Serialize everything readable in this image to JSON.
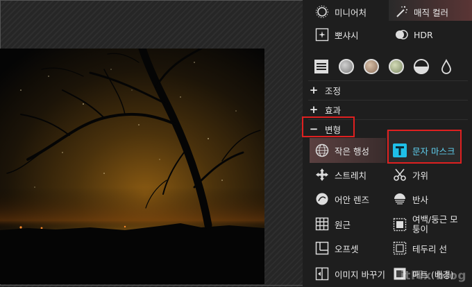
{
  "panel": {
    "top_items": [
      {
        "name": "miniature",
        "label": "미니어처",
        "icon": "sun-dial-icon"
      },
      {
        "name": "magic-color",
        "label": "매직 컬러",
        "icon": "magic-wand-icon"
      },
      {
        "name": "sparkle",
        "label": "뽀샤시",
        "icon": "sparkle-icon"
      },
      {
        "name": "hdr",
        "label": "HDR",
        "icon": "hdr-icon"
      }
    ],
    "sections": {
      "adjust": {
        "sign": "+",
        "label": "조정"
      },
      "effect": {
        "sign": "+",
        "label": "효과"
      },
      "transform": {
        "sign": "−",
        "label": "변형"
      }
    },
    "transform_items": {
      "left": [
        {
          "name": "small-planet",
          "label": "작은 행성",
          "icon": "globe-icon"
        },
        {
          "name": "stretch",
          "label": "스트레치",
          "icon": "move-arrows-icon"
        },
        {
          "name": "fisheye",
          "label": "어안 렌즈",
          "icon": "fisheye-lens-icon"
        },
        {
          "name": "perspective",
          "label": "원근",
          "icon": "perspective-grid-icon"
        },
        {
          "name": "offset",
          "label": "오프셋",
          "icon": "offset-icon"
        },
        {
          "name": "replace-image",
          "label": "이미지 바꾸기",
          "icon": "replace-image-icon"
        }
      ],
      "right": [
        {
          "name": "text-mask",
          "label": "문자 마스크",
          "icon": "text-t-icon"
        },
        {
          "name": "cut",
          "label": "가위",
          "icon": "scissors-icon"
        },
        {
          "name": "reflect",
          "label": "반사",
          "icon": "reflect-icon"
        },
        {
          "name": "margin-rounded",
          "label": "여백/둥근 모",
          "label2": "퉁이",
          "icon": "margin-frame-icon"
        },
        {
          "name": "border-line",
          "label": "테두리 선",
          "icon": "border-line-icon"
        },
        {
          "name": "matte",
          "label": "매트 (배경)",
          "icon": "matte-icon"
        }
      ]
    }
  },
  "watermark": "itFix blog",
  "colors": {
    "panel_bg": "#1e1e1e",
    "highlight_red": "#e02020",
    "text_mask_icon": "#1fc0e8",
    "circle_colors": [
      "#b8b8b8",
      "#b89c86",
      "#b4bf9a"
    ]
  }
}
